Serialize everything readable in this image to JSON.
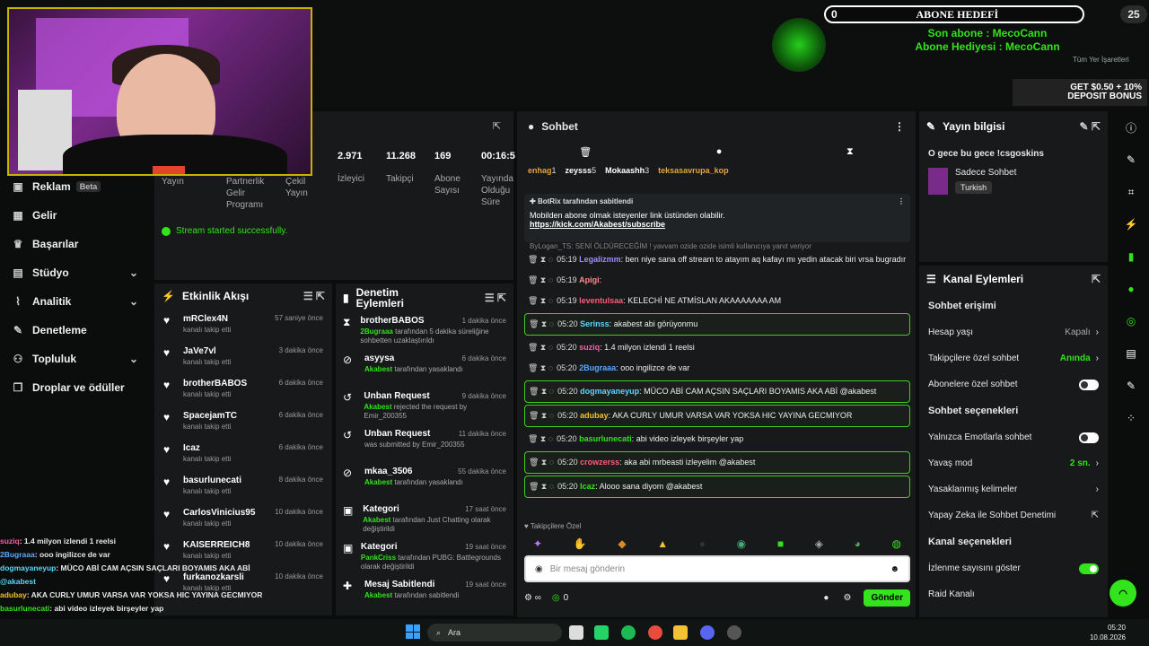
{
  "overlay": {
    "sub_goal_current": "0",
    "sub_goal_label": "ABONE HEDEFİ",
    "sub_goal_target": "25",
    "last_sub": "Son abone : MecoCann",
    "last_gift": "Abone Hediyesi : MecoCann",
    "all_notifications": "Tüm Yer İşaretleri",
    "banner_line1": "GET $0.50 + 10%",
    "banner_line2": "DEPOSIT BONUS"
  },
  "sidebar": {
    "items": [
      {
        "label": "Reklam",
        "badge": "Beta",
        "icon": "ad-icon"
      },
      {
        "label": "Gelir",
        "icon": "chart-icon"
      },
      {
        "label": "Başarılar",
        "icon": "trophy-icon"
      },
      {
        "label": "Stüdyo",
        "icon": "studio-icon",
        "expand": true
      },
      {
        "label": "Analitik",
        "icon": "analytics-icon",
        "expand": true
      },
      {
        "label": "Denetleme",
        "icon": "wrench-icon"
      },
      {
        "label": "Topluluk",
        "icon": "community-icon",
        "expand": true
      },
      {
        "label": "Droplar ve ödüller",
        "icon": "gift-icon"
      }
    ]
  },
  "stats": {
    "col1": "Yayın",
    "col2a": "Partnerlik",
    "col2b": "Gelir",
    "col2c": "Programı",
    "col3a": "Çekil",
    "col3b": "Yayın",
    "viewers_value": "2.971",
    "viewers_label": "İzleyici",
    "followers_value": "11.268",
    "followers_label": "Takipçi",
    "subs_value": "169",
    "subs_label_a": "Abone",
    "subs_label_b": "Sayısı",
    "uptime_value": "00:16:5",
    "uptime_label_a": "Yayında",
    "uptime_label_b": "Olduğu",
    "uptime_label_c": "Süre",
    "status": "Stream started successfully."
  },
  "events": {
    "title": "Etkinlik Akışı",
    "items": [
      {
        "name": "mRClex4N",
        "sub": "kanalı takip etti",
        "time": "57 saniye önce"
      },
      {
        "name": "JaVe7vl",
        "sub": "kanalı takip etti",
        "time": "3 dakika önce"
      },
      {
        "name": "brotherBABOS",
        "sub": "kanalı takip etti",
        "time": "6 dakika önce"
      },
      {
        "name": "SpacejamTC",
        "sub": "kanalı takip etti",
        "time": "6 dakika önce"
      },
      {
        "name": "Icaz",
        "sub": "kanalı takip etti",
        "time": "6 dakika önce"
      },
      {
        "name": "basurlunecati",
        "sub": "kanalı takip etti",
        "time": "8 dakika önce"
      },
      {
        "name": "CarlosVinicius95",
        "sub": "kanalı takip etti",
        "time": "10 dakika önce"
      },
      {
        "name": "KAISERREICH8",
        "sub": "kanalı takip etti",
        "time": "10 dakika önce"
      },
      {
        "name": "furkanozkarsli",
        "sub": "kanalı takip etti",
        "time": "10 dakika önce"
      }
    ]
  },
  "mod_actions": {
    "title_a": "Denetim",
    "title_b": "Eylemleri",
    "items": [
      {
        "name": "brotherBABOS",
        "d1": "2Bugraaa",
        "d2": " tarafından 5 dakika süreliğine sohbetten uzaklaştırıldı",
        "time": "1 dakika önce",
        "icon": "hourglass-icon"
      },
      {
        "name": "asyysa",
        "d1": "Akabest",
        "d2": " tarafından yasaklandı",
        "time": "6 dakika önce",
        "icon": "ban-icon"
      },
      {
        "name": "Unban Request",
        "d1": "Akabest",
        "d2": " rejected the request by Emir_200355",
        "time": "9 dakika önce",
        "icon": "undo-icon"
      },
      {
        "name": "Unban Request",
        "d1": "",
        "d2": "was submitted by Emir_200355",
        "time": "11 dakika önce",
        "icon": "undo-icon"
      },
      {
        "name": "mkaa_3506",
        "d1": "Akabest",
        "d2": " tarafından yasaklandı",
        "time": "55 dakika önce",
        "icon": "ban-icon"
      },
      {
        "name": "Kategori",
        "d1": "Akabest",
        "d2": " tarafından Just Chatting olarak değiştirildi",
        "time": "17 saat önce",
        "icon": "category-icon"
      },
      {
        "name": "Kategori",
        "d1": "PankCriss",
        "d2": " tarafından PUBG: Battlegrounds olarak değiştirildi",
        "time": "19 saat önce",
        "icon": "category-icon"
      },
      {
        "name": "Mesaj Sabitlendi",
        "d1": "Akabest",
        "d2": " tarafından sabitlendi",
        "time": "19 saat önce",
        "icon": "pin-icon"
      }
    ]
  },
  "chat": {
    "title": "Sohbet",
    "leaders": [
      {
        "name": "enhag",
        "count": "1",
        "color": "#e7a43b"
      },
      {
        "name": "zeysss",
        "count": "5",
        "color": "#ffffff"
      },
      {
        "name": "Mokaashh",
        "count": "3",
        "color": "#ffffff"
      },
      {
        "name": "teksasavrupa_kop",
        "count": "",
        "color": "#e7a43b"
      }
    ],
    "pinned_by": "BotRix tarafından sabitlendi",
    "pinned_msg": "Mobilden abone olmak isteyenler link üstünden olabilir.",
    "pinned_link": "https://kick.com/Akabest/subscribe",
    "reply_hint": "ByLogan_TS: SENİ ÖLDÜRECEĞİM ! yavvam ozide ozide isimli kullanıcıya yanıt veriyor",
    "messages": [
      {
        "time": "05:19",
        "user": "Legalizmm",
        "color": "#9f8cff",
        "text": "ben niye sana off stream to atayım aq kafayı mı yedin atacak biri vrsa bugradır",
        "hl": false
      },
      {
        "time": "05:19",
        "user": "Apigi",
        "color": "#ff8c8c",
        "text": "",
        "hl": false
      },
      {
        "time": "05:19",
        "user": "leventulsaa",
        "color": "#ff5c7a",
        "text": "KELECHİ NE ATMİSLAN AKAAAAAAA AM",
        "hl": false
      },
      {
        "time": "05:20",
        "user": "Serinss",
        "color": "#5ad7ff",
        "text": "akabest abi görüyonmu",
        "hl": true
      },
      {
        "time": "05:20",
        "user": "suziq",
        "color": "#ff5ca8",
        "text": "1.4 milyon izlendi 1 reelsi",
        "hl": false
      },
      {
        "time": "05:20",
        "user": "2Bugraaa",
        "color": "#5aa8ff",
        "text": "ooo ingilizce de var",
        "hl": false
      },
      {
        "time": "05:20",
        "user": "dogmayaneyup",
        "color": "#5ad7ff",
        "text": "MÜCO ABİ CAM AÇSIN SAÇLARI BOYAMIS AKA ABİ @akabest",
        "hl": true
      },
      {
        "time": "05:20",
        "user": "adubay",
        "color": "#f1c232",
        "text": "AKA CURLY UMUR VARSA VAR YOKSA HIC YAYINA GECMIYOR",
        "hl": true
      },
      {
        "time": "05:20",
        "user": "basurlunecati",
        "color": "#33e31b",
        "text": "abi video izleyek birşeyler yap",
        "hl": false
      },
      {
        "time": "05:20",
        "user": "crowzerss",
        "color": "#ff5c7a",
        "text": "aka abi mrbeasti izleyelim @akabest",
        "hl": true
      },
      {
        "time": "05:20",
        "user": "Icaz",
        "color": "#33e31b",
        "text": "Alooo sana diyom @akabest",
        "hl": true
      }
    ],
    "followers_only": "Takipçilere Özel",
    "placeholder": "Bir mesaj gönderin",
    "points": "0",
    "send_label": "Gönder"
  },
  "stream_info": {
    "title": "Yayın bilgisi",
    "stream_title": "O gece bu gece !csgoskins",
    "category": "Sadece Sohbet",
    "tag": "Turkish"
  },
  "channel_actions": {
    "title": "Kanal Eylemleri",
    "sec1": "Sohbet erişimi",
    "account_age": "Hesap yaşı",
    "account_age_value": "Kapalı",
    "followers_chat": "Takipçilere özel sohbet",
    "followers_chat_value": "Anında",
    "subs_chat": "Abonelere özel sohbet",
    "sec2": "Sohbet seçenekleri",
    "emotes_only": "Yalnızca Emotlarla sohbet",
    "slow_mode": "Yavaş mod",
    "slow_mode_value": "2 sn.",
    "banned_words": "Yasaklanmış kelimeler",
    "ai_mod": "Yapay Zeka ile Sohbet Denetimi",
    "sec3": "Kanal seçenekleri",
    "show_views": "İzlenme sayısını göster",
    "raid": "Raid Kanalı"
  },
  "overlay_chat": [
    {
      "user": "suziq",
      "color": "#ff5ca8",
      "text": ": 1.4 milyon izlendi 1 reelsi"
    },
    {
      "user": "2Bugraaa",
      "color": "#5aa8ff",
      "text": ": ooo ingilizce de var"
    },
    {
      "user": "dogmayaneyup",
      "color": "#5ad7ff",
      "text": ": MÜCO ABİ CAM AÇSIN SAÇLARI BOYAMIS AKA ABİ"
    },
    {
      "user": "@akabest",
      "color": "#5ad7ff",
      "text": ""
    },
    {
      "user": "adubay",
      "color": "#f1c232",
      "text": ": AKA CURLY UMUR VARSA VAR YOKSA HIC YAYINA GECMIYOR"
    },
    {
      "user": "basurlunecati",
      "color": "#33e31b",
      "text": ": abi video izleyek birşeyler yap"
    },
    {
      "user": "crowzerss",
      "color": "#ff5c7a",
      "text": ": aka abi mrbeasti izleyelim @akabest"
    }
  ],
  "taskbar": {
    "search": "Ara",
    "time": "05:20",
    "date": "10.08.2026"
  }
}
